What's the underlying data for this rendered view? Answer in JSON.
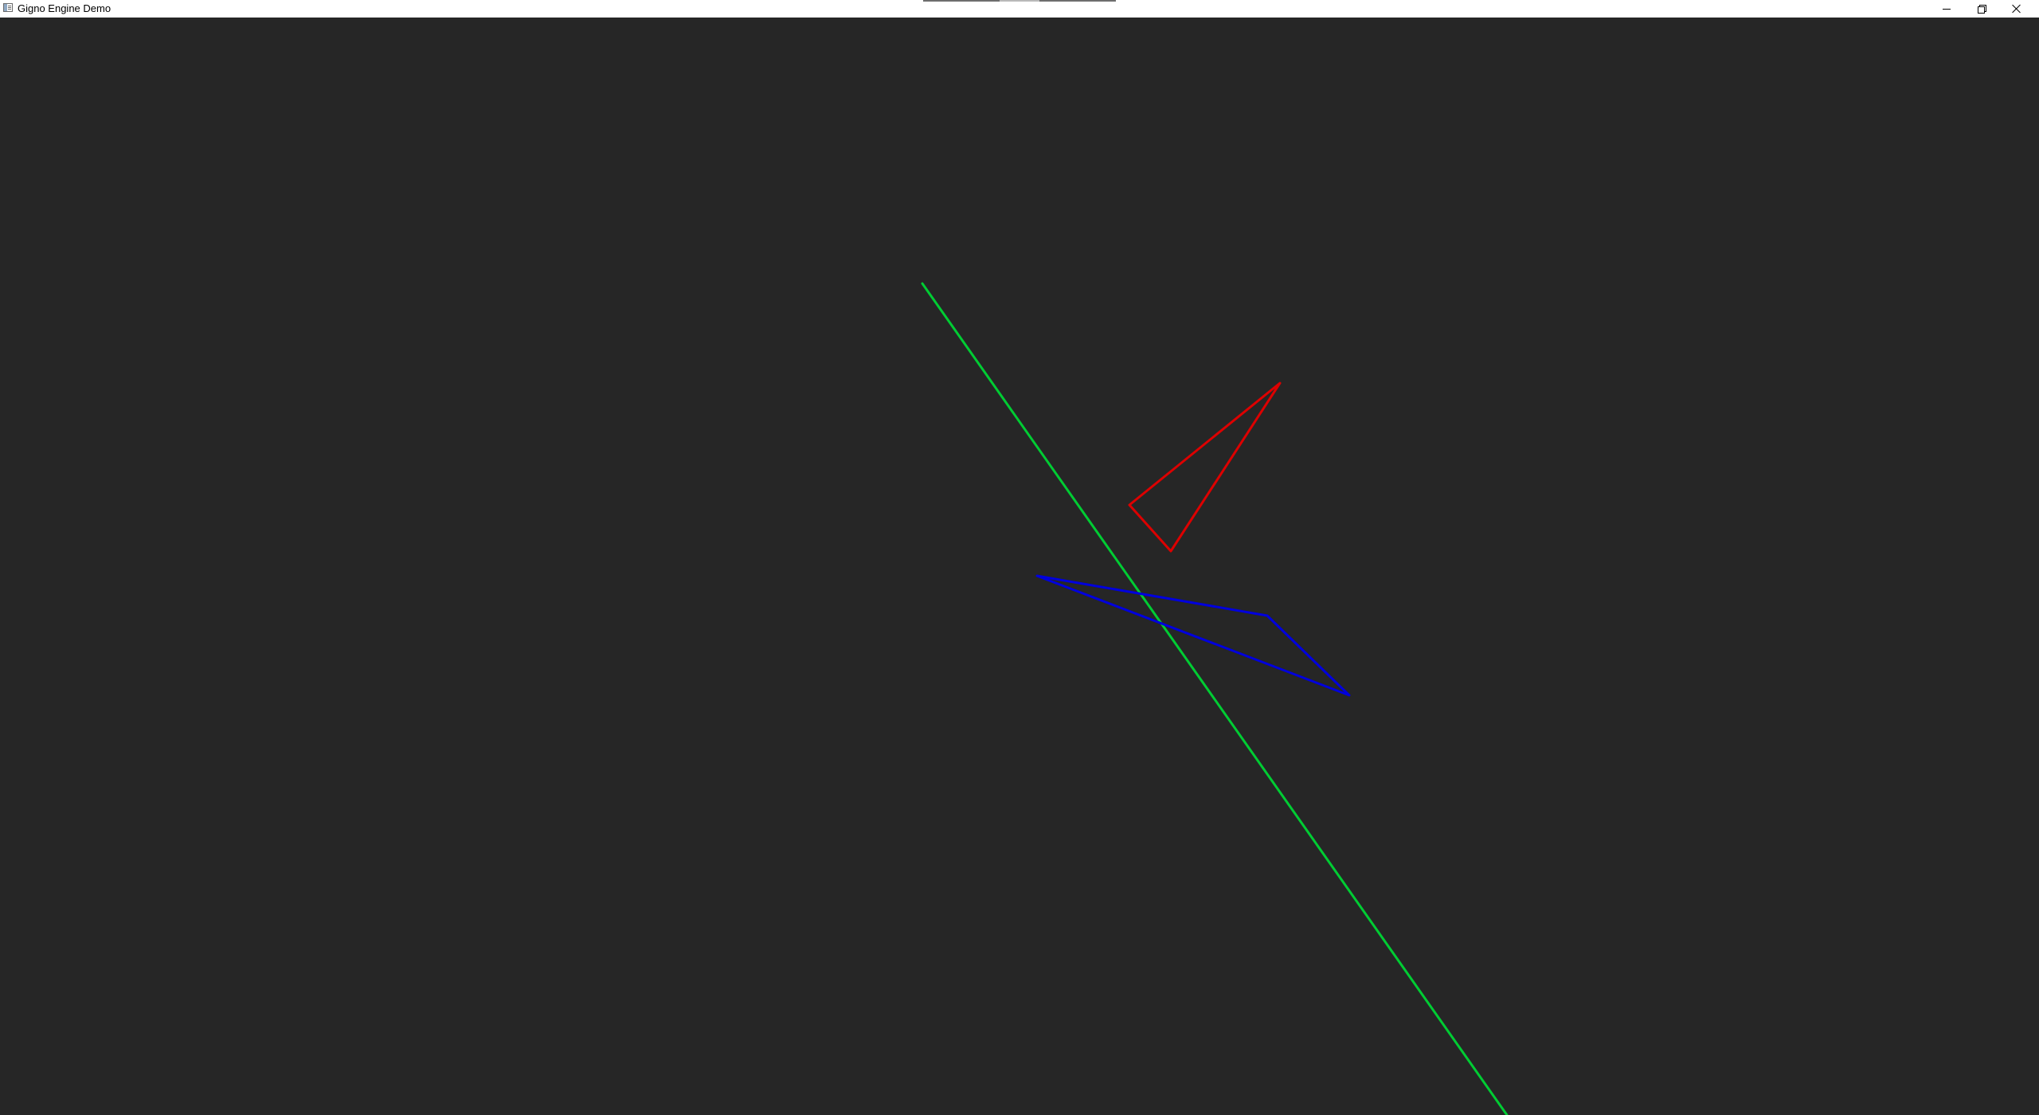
{
  "window": {
    "title": "Gigno Engine Demo",
    "controls": {
      "minimize_icon": "minimize-icon",
      "restore_icon": "restore-icon",
      "close_icon": "close-icon"
    }
  },
  "scene": {
    "background_color": "#262626",
    "shapes": [
      {
        "name": "green-line",
        "kind": "line",
        "color": "#00cc33"
      },
      {
        "name": "red-triangle",
        "kind": "triangle",
        "color": "#dd0000"
      },
      {
        "name": "blue-triangle",
        "kind": "triangle",
        "color": "#0000dd"
      }
    ]
  }
}
